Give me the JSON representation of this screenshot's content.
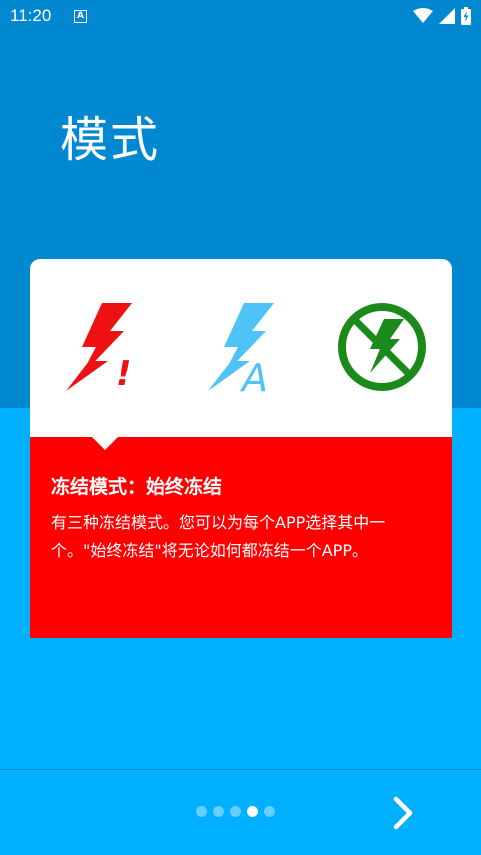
{
  "status_bar": {
    "time": "11:20",
    "input_indicator": "A"
  },
  "header": {
    "title": "模式"
  },
  "card": {
    "icons": [
      "always-freeze-icon",
      "auto-freeze-icon",
      "never-freeze-icon"
    ],
    "heading": "冻结模式：始终冻结",
    "description": "有三种冻结模式。您可以为每个APP选择其中一个。\"始终冻结\"将无论如何都冻结一个APP。",
    "colors": {
      "panel": "#FF0000",
      "always_icon": "#EE1111",
      "auto_icon": "#4FC3F7",
      "never_icon": "#1B8A1B"
    }
  },
  "pager": {
    "page_count": 5,
    "current_page": 4
  },
  "colors": {
    "top_background": "#0288D1",
    "bottom_background": "#00B0FF"
  }
}
